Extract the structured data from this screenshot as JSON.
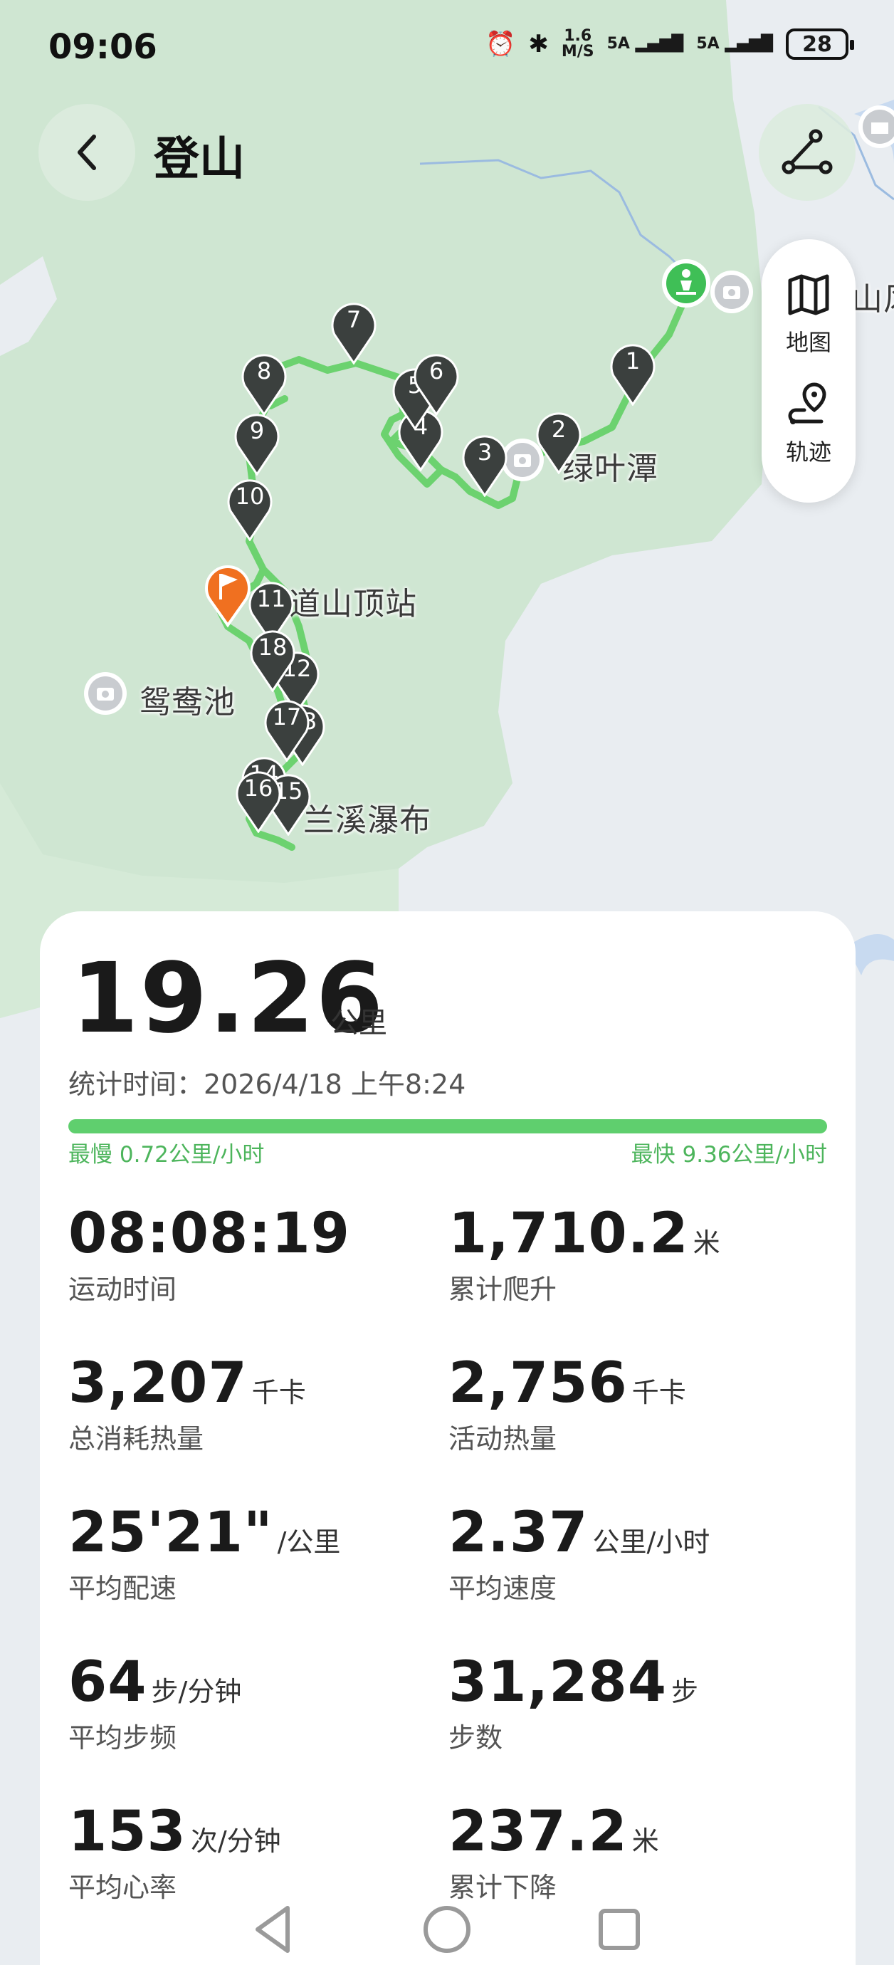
{
  "status_bar": {
    "time": "09:06",
    "netspeed_top": "1.6",
    "netspeed_bottom": "M/S",
    "signal1": "5A",
    "signal2": "5A",
    "battery": "28"
  },
  "header": {
    "title": "登山"
  },
  "side_panel": {
    "map_label": "地图",
    "track_label": "轨迹"
  },
  "map": {
    "labels": {
      "lake": "绿叶潭",
      "station": "道山顶站",
      "pond": "鸳鸯池",
      "waterfall": "兰溪瀑布",
      "edge": "山风"
    },
    "pins": [
      "1",
      "2",
      "3",
      "4",
      "5",
      "6",
      "7",
      "8",
      "9",
      "10",
      "11",
      "12",
      "13",
      "14",
      "15",
      "16",
      "17",
      "18"
    ]
  },
  "summary": {
    "distance": "19.26",
    "distance_unit": "公里",
    "stat_time": "统计时间：2026/4/18 上午8:24",
    "slowest": "最慢 0.72公里/小时",
    "fastest": "最快 9.36公里/小时"
  },
  "metrics": [
    {
      "value": "08:08:19",
      "unit": "",
      "label": "运动时间"
    },
    {
      "value": "1,710.2",
      "unit": "米",
      "label": "累计爬升"
    },
    {
      "value": "3,207",
      "unit": "千卡",
      "label": "总消耗热量"
    },
    {
      "value": "2,756",
      "unit": "千卡",
      "label": "活动热量"
    },
    {
      "value": "25'21\"",
      "unit": "/公里",
      "label": "平均配速"
    },
    {
      "value": "2.37",
      "unit": "公里/小时",
      "label": "平均速度"
    },
    {
      "value": "64",
      "unit": "步/分钟",
      "label": "平均步频"
    },
    {
      "value": "31,284",
      "unit": "步",
      "label": "步数"
    },
    {
      "value": "153",
      "unit": "次/分钟",
      "label": "平均心率"
    },
    {
      "value": "237.2",
      "unit": "米",
      "label": "累计下降"
    }
  ]
}
